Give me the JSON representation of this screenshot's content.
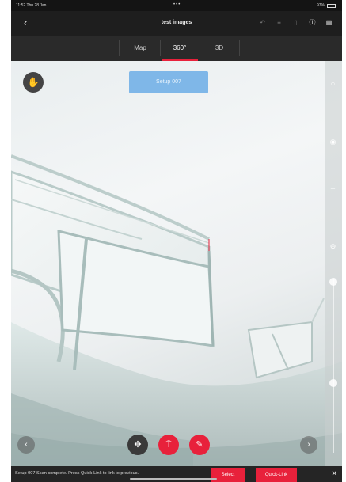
{
  "status_bar": {
    "time": "11:52  Thu 28 Jan",
    "dots": "•••",
    "battery": "97%"
  },
  "nav": {
    "back_icon": "chevron-left-icon",
    "title": "test images",
    "tools": [
      "undo-icon",
      "list-icon",
      "lock-icon",
      "info-icon",
      "layers-icon"
    ]
  },
  "tabs": [
    {
      "label": "Map"
    },
    {
      "label": "360°"
    },
    {
      "label": "3D"
    }
  ],
  "viewer": {
    "setup_label": "Setup 007",
    "hand_icon": "hand-pan-icon"
  },
  "bottom_bar": {
    "message": "Setup 007 Scan complete. Press Quick-Link to link to previous.",
    "select_label": "Select",
    "quicklink_label": "Quick-Link",
    "close_glyph": "✕"
  },
  "colors": {
    "accent": "#e8213b",
    "setup_pill": "#7fb7e8",
    "dark_bar": "#1e1e1e"
  }
}
